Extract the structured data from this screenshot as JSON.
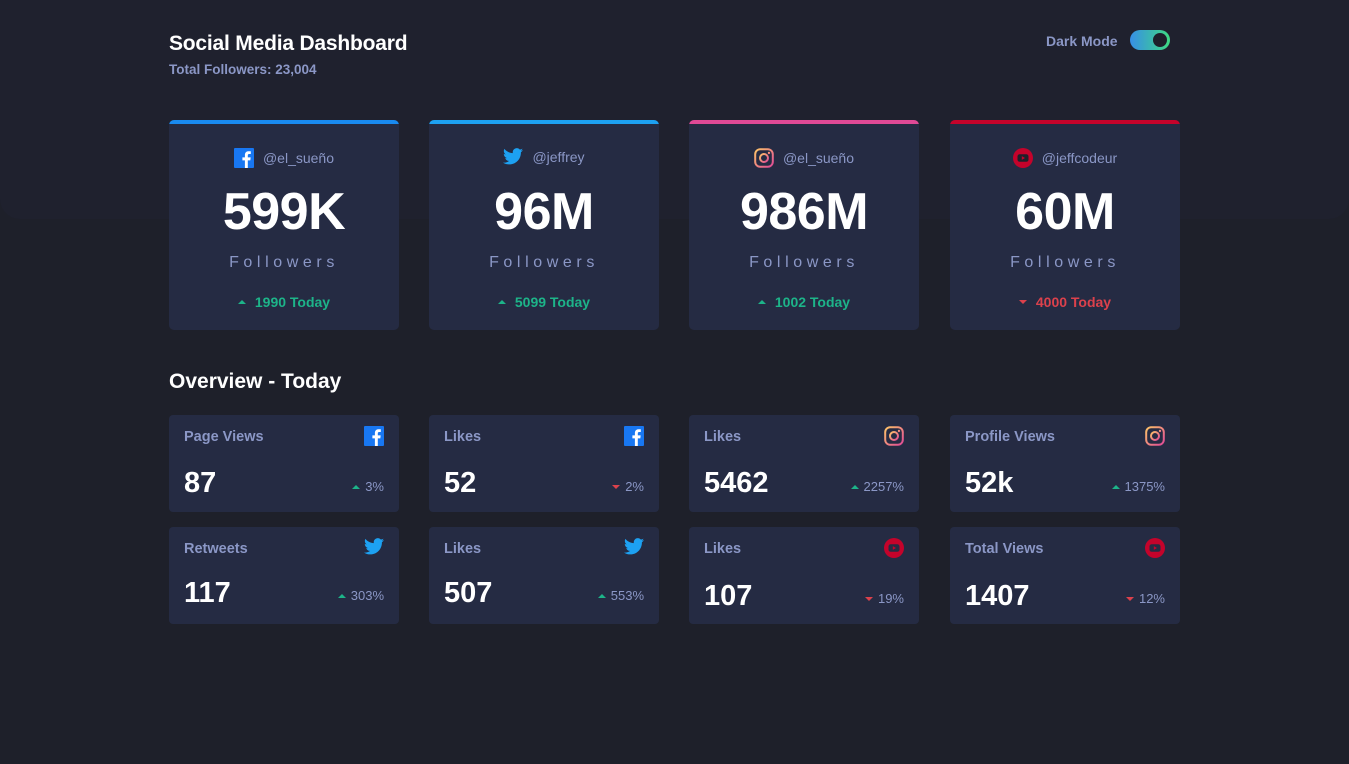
{
  "header": {
    "title": "Social Media Dashboard",
    "total_followers": "Total Followers: 23,004",
    "mode_label": "Dark Mode",
    "dark_mode_on": true
  },
  "colors": {
    "facebook": "#1877f2",
    "twitter": "#1da1f2",
    "instagram_start": "#fdc468",
    "instagram_end": "#df4996",
    "youtube": "#c4032b",
    "up": "#1db489",
    "down": "#dc414c"
  },
  "follower_cards": [
    {
      "network": "facebook",
      "icon": "facebook-icon",
      "handle": "@el_sueño",
      "count": "599K",
      "unit": "Followers",
      "today": "1990 Today",
      "trend": "up"
    },
    {
      "network": "twitter",
      "icon": "twitter-icon",
      "handle": "@jeffrey",
      "count": "96M",
      "unit": "Followers",
      "today": "5099 Today",
      "trend": "up"
    },
    {
      "network": "instagram",
      "icon": "instagram-icon",
      "handle": "@el_sueño",
      "count": "986M",
      "unit": "Followers",
      "today": "1002 Today",
      "trend": "up"
    },
    {
      "network": "youtube",
      "icon": "youtube-icon",
      "handle": "@jeffcodeur",
      "count": "60M",
      "unit": "Followers",
      "today": "4000 Today",
      "trend": "down"
    }
  ],
  "overview": {
    "title": "Overview - Today",
    "tiles": [
      {
        "label": "Page Views",
        "icon": "facebook-icon",
        "value": "87",
        "change": "3%",
        "trend": "up"
      },
      {
        "label": "Likes",
        "icon": "facebook-icon",
        "value": "52",
        "change": "2%",
        "trend": "down"
      },
      {
        "label": "Likes",
        "icon": "instagram-icon",
        "value": "5462",
        "change": "2257%",
        "trend": "up"
      },
      {
        "label": "Profile Views",
        "icon": "instagram-icon",
        "value": "52k",
        "change": "1375%",
        "trend": "up"
      },
      {
        "label": "Retweets",
        "icon": "twitter-icon",
        "value": "117",
        "change": "303%",
        "trend": "up"
      },
      {
        "label": "Likes",
        "icon": "twitter-icon",
        "value": "507",
        "change": "553%",
        "trend": "up"
      },
      {
        "label": "Likes",
        "icon": "youtube-icon",
        "value": "107",
        "change": "19%",
        "trend": "down"
      },
      {
        "label": "Total Views",
        "icon": "youtube-icon",
        "value": "1407",
        "change": "12%",
        "trend": "down"
      }
    ]
  }
}
